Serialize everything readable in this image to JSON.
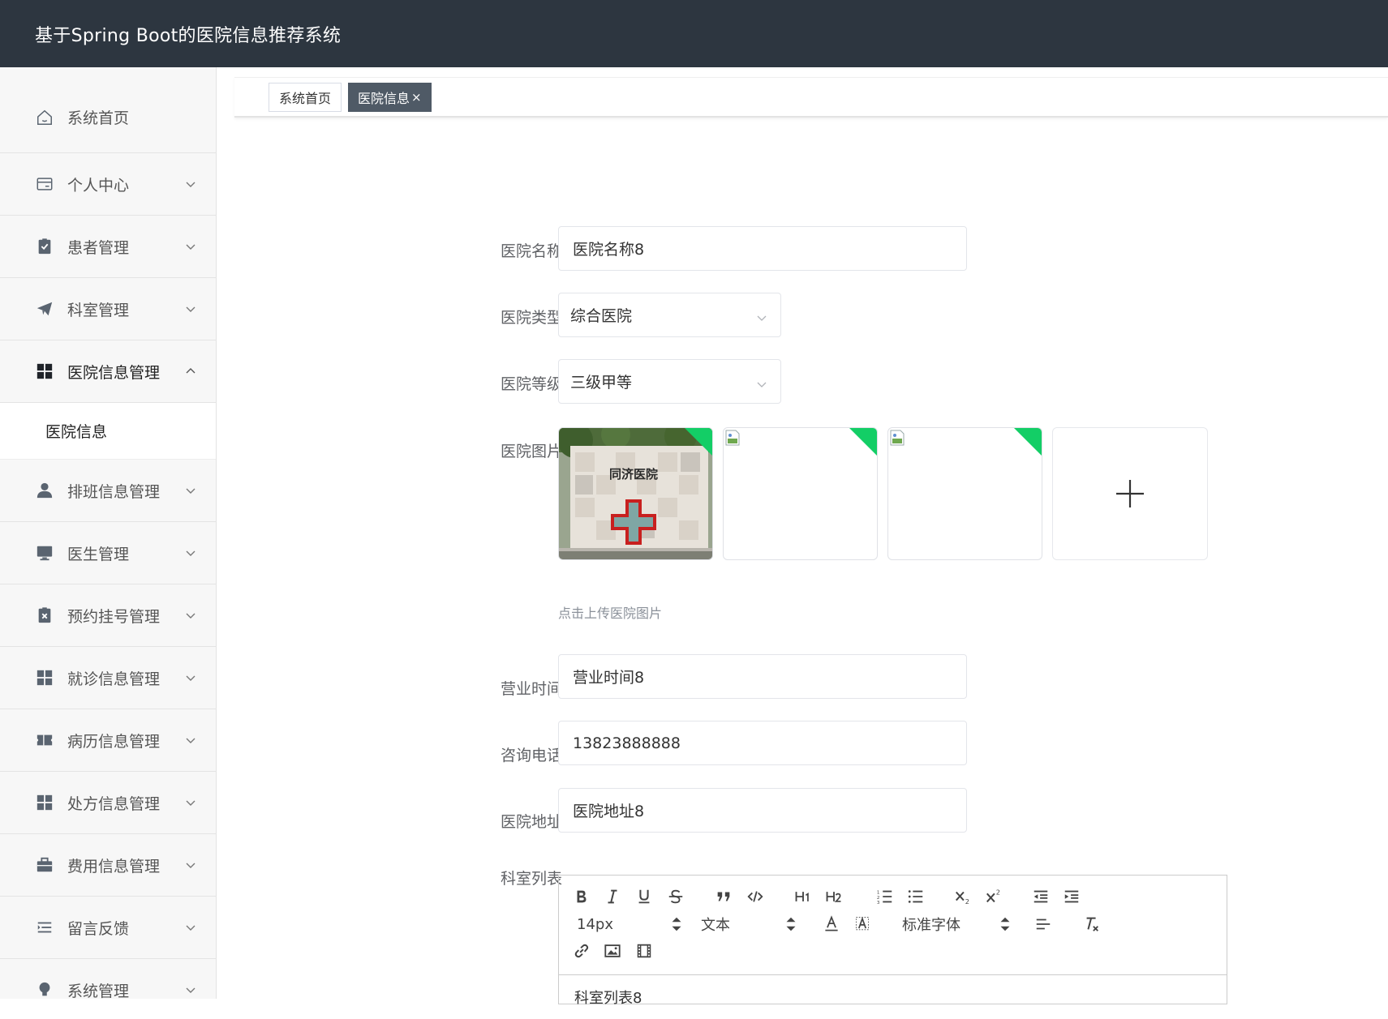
{
  "header": {
    "title": "基于Spring Boot的医院信息推荐系统"
  },
  "sidebar": {
    "items": [
      {
        "label": "系统首页",
        "icon": "home-icon"
      },
      {
        "label": "个人中心",
        "icon": "card-icon"
      },
      {
        "label": "患者管理",
        "icon": "clipboard-check-icon"
      },
      {
        "label": "科室管理",
        "icon": "paper-plane-icon"
      },
      {
        "label": "医院信息管理",
        "icon": "grid-icon",
        "expanded": true
      },
      {
        "label": "排班信息管理",
        "icon": "user-icon"
      },
      {
        "label": "医生管理",
        "icon": "monitor-icon"
      },
      {
        "label": "预约挂号管理",
        "icon": "clipboard-x-icon"
      },
      {
        "label": "就诊信息管理",
        "icon": "grid-icon"
      },
      {
        "label": "病历信息管理",
        "icon": "ticket-icon"
      },
      {
        "label": "处方信息管理",
        "icon": "grid-icon"
      },
      {
        "label": "费用信息管理",
        "icon": "briefcase-icon"
      },
      {
        "label": "留言反馈",
        "icon": "list-indent-icon"
      },
      {
        "label": "系统管理",
        "icon": "lightbulb-icon"
      }
    ],
    "submenu": {
      "label": "医院信息"
    }
  },
  "tabs": [
    {
      "label": "系统首页"
    },
    {
      "label": "医院信息",
      "close": "×",
      "active": true
    }
  ],
  "form": {
    "name": {
      "label": "医院名称",
      "value": "医院名称8"
    },
    "type": {
      "label": "医院类型",
      "value": "综合医院"
    },
    "level": {
      "label": "医院等级",
      "value": "三级甲等"
    },
    "images": {
      "label": "医院图片",
      "hint": "点击上传医院图片",
      "photo_sign": "同济医院"
    },
    "hours": {
      "label": "营业时间",
      "value": "营业时间8"
    },
    "phone": {
      "label": "咨询电话",
      "value": "13823888888"
    },
    "address": {
      "label": "医院地址",
      "value": "医院地址8"
    },
    "departments": {
      "label": "科室列表",
      "content": "科室列表8"
    }
  },
  "editor": {
    "font_size": "14px",
    "header": "文本",
    "font": "标准字体"
  },
  "colors": {
    "header_bg": "#2d3640",
    "sidebar_bg": "#f7f7f7",
    "active_tab_bg": "#4f5a66",
    "upload_success": "#13ce66"
  }
}
